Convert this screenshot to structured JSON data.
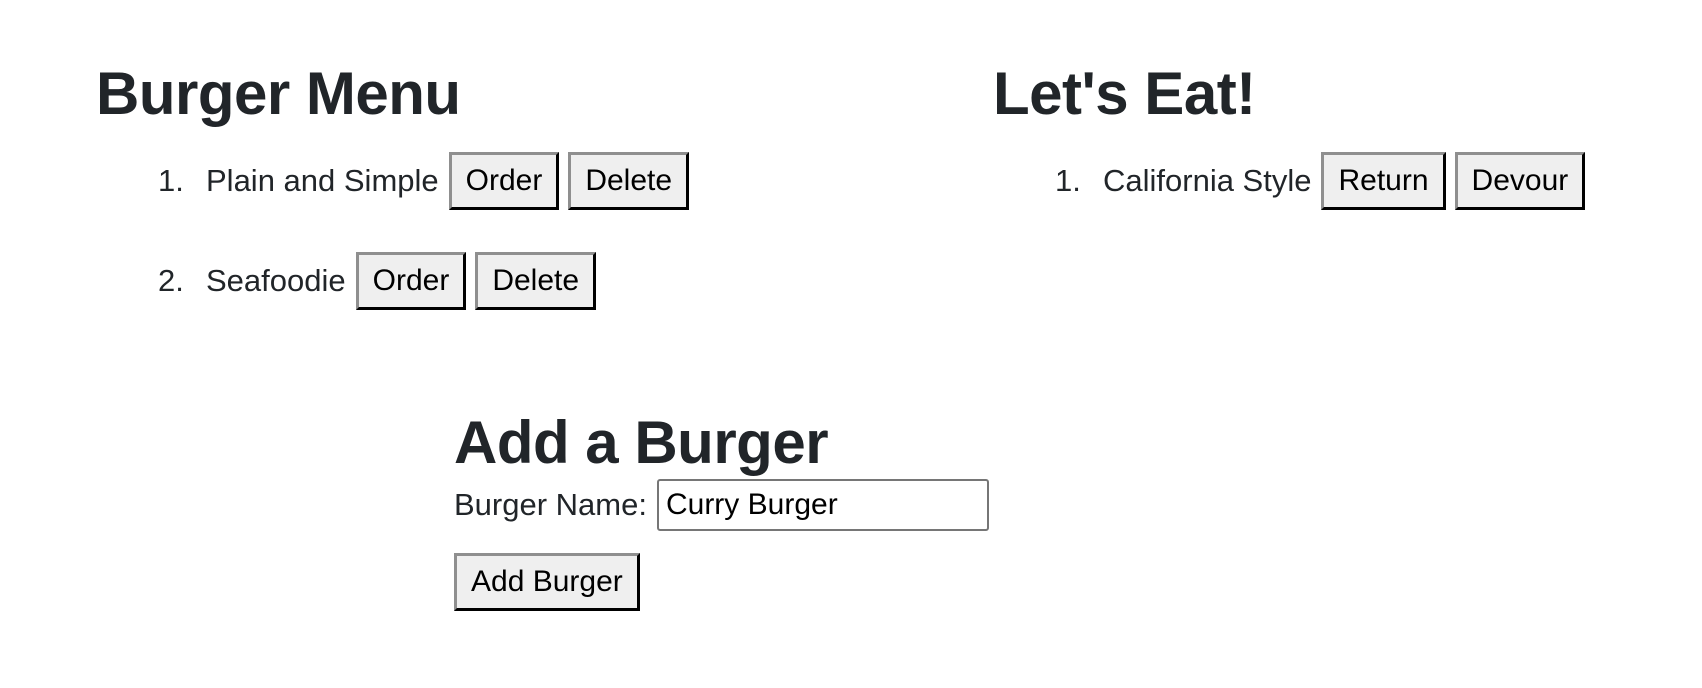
{
  "menu": {
    "title": "Burger Menu",
    "items": [
      {
        "name": "Plain and Simple",
        "order_label": "Order",
        "delete_label": "Delete"
      },
      {
        "name": "Seafoodie",
        "order_label": "Order",
        "delete_label": "Delete"
      }
    ]
  },
  "eat": {
    "title": "Let's Eat!",
    "items": [
      {
        "name": "California Style",
        "return_label": "Return",
        "devour_label": "Devour"
      }
    ]
  },
  "add": {
    "title": "Add a Burger",
    "name_label": "Burger Name:",
    "name_value": "Curry Burger",
    "submit_label": "Add Burger"
  }
}
